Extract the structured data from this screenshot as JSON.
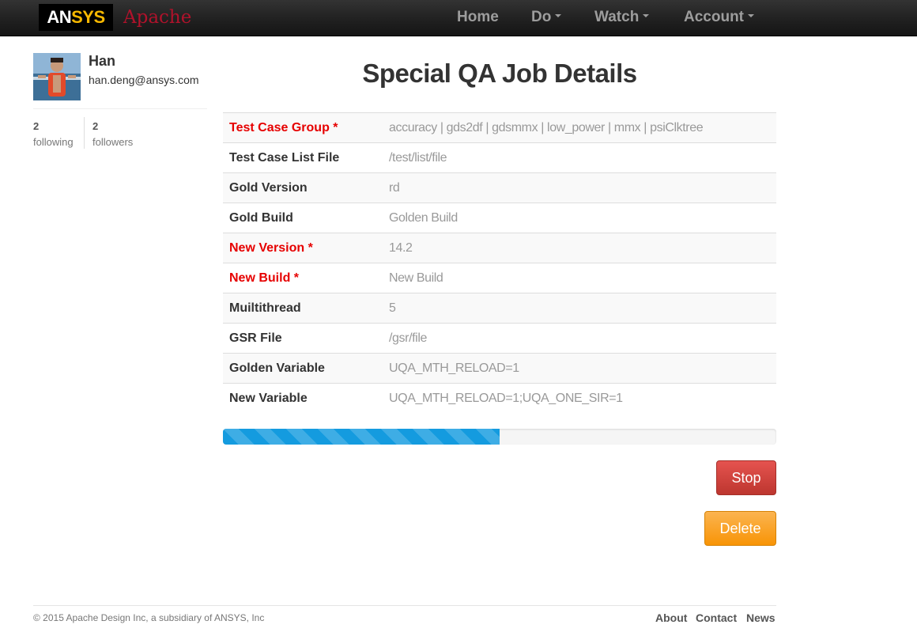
{
  "navbar": {
    "logo_part1": "AN",
    "logo_part2": "SYS",
    "brand": "Apache",
    "items": [
      {
        "label": "Home",
        "dropdown": false
      },
      {
        "label": "Do",
        "dropdown": true
      },
      {
        "label": "Watch",
        "dropdown": true
      },
      {
        "label": "Account",
        "dropdown": true
      }
    ]
  },
  "profile": {
    "name": "Han",
    "email": "han.deng@ansys.com",
    "following_count": "2",
    "following_label": "following",
    "followers_count": "2",
    "followers_label": "followers"
  },
  "page": {
    "title": "Special QA Job Details"
  },
  "details": [
    {
      "label": "Test Case Group *",
      "value": "accuracy | gds2df | gdsmmx | low_power | mmx | psiClktree",
      "required": true
    },
    {
      "label": "Test Case List File",
      "value": "/test/list/file",
      "required": false
    },
    {
      "label": "Gold Version",
      "value": "rd",
      "required": false
    },
    {
      "label": "Gold Build",
      "value": "Golden Build",
      "required": false
    },
    {
      "label": "New Version *",
      "value": "14.2",
      "required": true
    },
    {
      "label": "New Build *",
      "value": "New Build",
      "required": true
    },
    {
      "label": "Muiltithread",
      "value": "5",
      "required": false
    },
    {
      "label": "GSR File",
      "value": "/gsr/file",
      "required": false
    },
    {
      "label": "Golden Variable",
      "value": "UQA_MTH_RELOAD=1",
      "required": false
    },
    {
      "label": "New Variable",
      "value": "UQA_MTH_RELOAD=1;UQA_ONE_SIR=1",
      "required": false
    }
  ],
  "progress": {
    "percent": 50
  },
  "actions": {
    "stop_label": "Stop",
    "delete_label": "Delete"
  },
  "footer": {
    "copyright": "© 2015 Apache Design Inc, a subsidiary of ANSYS, Inc",
    "links": [
      "About",
      "Contact",
      "News"
    ]
  },
  "colors": {
    "required_label": "#e60000",
    "progress": "#149bdf",
    "stop_button": "#bd362f",
    "delete_button": "#f89406",
    "brand": "#b0122b"
  }
}
